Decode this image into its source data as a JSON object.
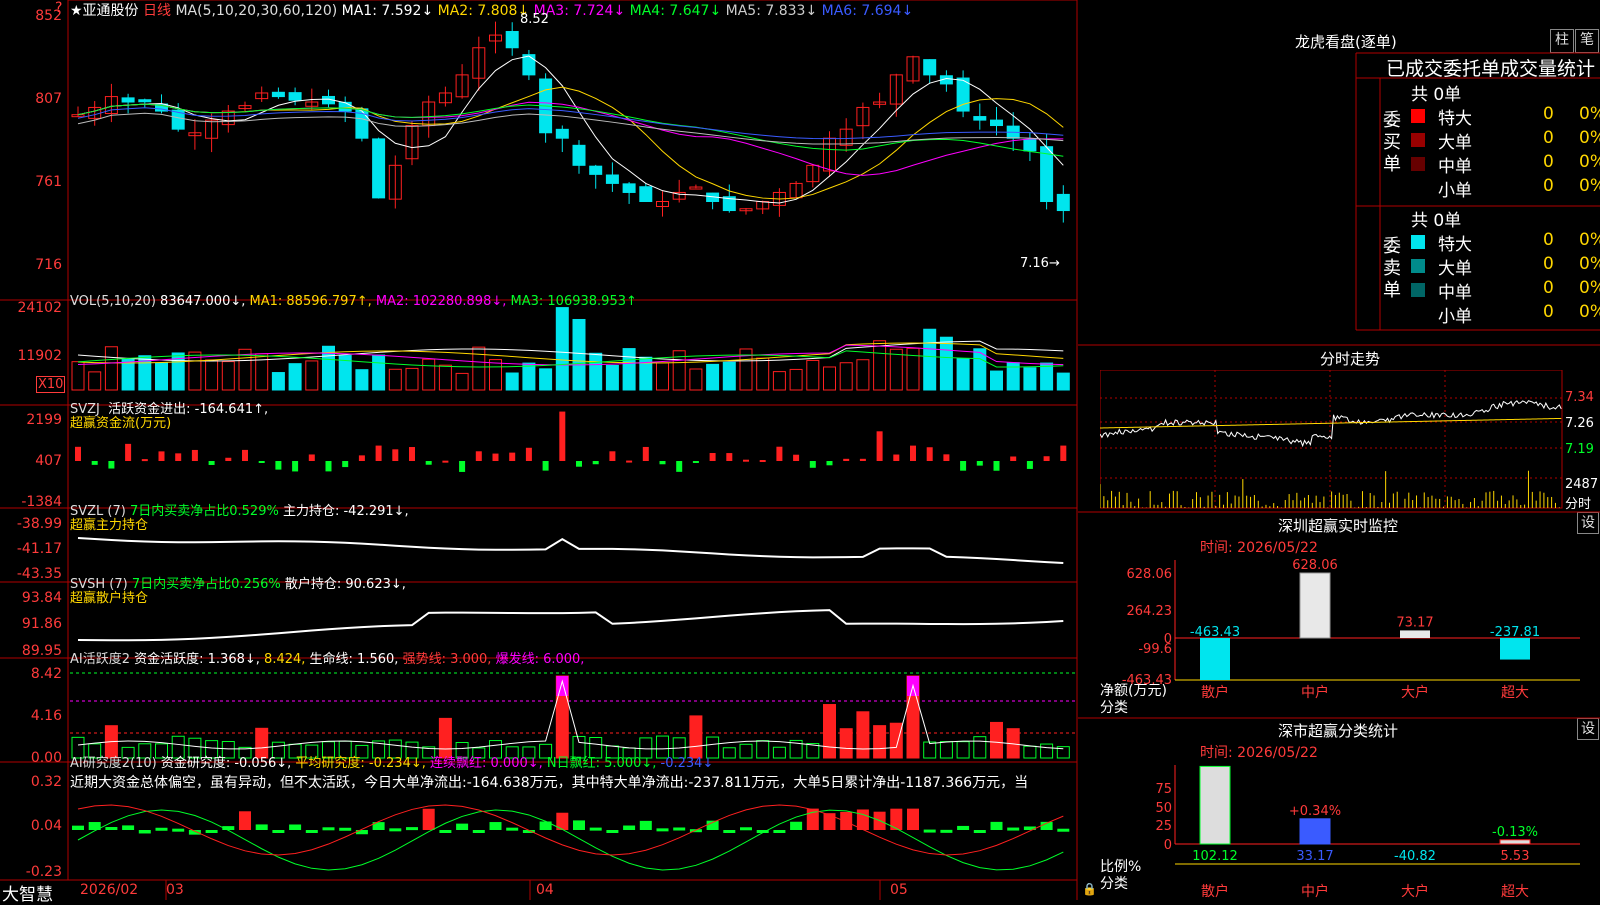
{
  "colors": {
    "up": "#ff2020",
    "down": "#00e5ee",
    "green": "#00ff2a",
    "yellow": "#ffd700",
    "magenta": "#ff00ff",
    "white": "#ffffff",
    "border": "#b00000",
    "blue": "#3a5bff"
  },
  "main": {
    "stock_name": "★亚通股份",
    "period": "日线",
    "ma_title": "MA(5,10,20,30,60,120)",
    "ma": [
      {
        "t": "MA1: 7.592↓",
        "c": "#fff"
      },
      {
        "t": "MA2: 7.808↓",
        "c": "#ffd700"
      },
      {
        "t": "MA3: 7.724↓",
        "c": "#ff00ff"
      },
      {
        "t": "MA4: 7.647↓",
        "c": "#00ff2a"
      },
      {
        "t": "MA5: 7.833↓",
        "c": "#ccc"
      },
      {
        "t": "MA6: 7.694↓",
        "c": "#3a5bff"
      }
    ],
    "axis": [
      "852",
      "807",
      "761",
      "716"
    ],
    "high_label": "8.52",
    "low_label": "7.16→"
  },
  "vol": {
    "title": "VOL(5,10,20)",
    "v": "83647.000↓,",
    "ma1": "MA1: 88596.797↑,",
    "ma2": "MA2: 102280.898↓,",
    "ma3": "MA3: 106938.953↑",
    "axis": [
      "24102",
      "11902"
    ],
    "unit": "X10"
  },
  "svzj": {
    "title": "SVZJ",
    "line1": "活跃资金进出: -164.641↑,",
    "line2": "超赢资金流(万元)",
    "axis": [
      "2199",
      "407",
      "-1384"
    ]
  },
  "svzl": {
    "title": "SVZL (7)",
    "pct": "7日内买卖净占比0.529%",
    "hold": "主力持仓: -42.291↓,",
    "line2": "超赢主力持仓",
    "axis": [
      "-38.99",
      "-41.17",
      "-43.35"
    ]
  },
  "svsh": {
    "title": "SVSH (7)",
    "pct": "7日内买卖净占比0.256%",
    "hold": "散户持仓: 90.623↓,",
    "line2": "超赢散户持仓",
    "axis": [
      "93.84",
      "91.86",
      "89.95"
    ]
  },
  "ai2": {
    "title": "AI活跃度2",
    "a": "资金活跃度: 1.368↓,",
    "b": "8.424,",
    "c": "生命线: 1.560,",
    "d": "强势线: 3.000,",
    "e": "爆发线: 6.000,",
    "axis": [
      "8.42",
      "4.16",
      "0.00"
    ]
  },
  "ai3": {
    "title": "AI研究度2(10)",
    "a": "资金研究度: -0.056↓,",
    "b": "平均研究度: -0.234↓,",
    "c": "连续飘红: 0.000↓,",
    "d": "N日飘红: 5.000↓,",
    "e": "-0.234↓",
    "desc": "近期大资金总体偏空，虽有异动，但不太活跃，今日大单净流出:-164.638万元，其中特大单净流出:-237.811万元，大单5日累计净出-1187.366万元，当",
    "axis": [
      "0.32",
      "0.04",
      "-0.23"
    ]
  },
  "date_axis": {
    "brand": "大智慧",
    "labels": [
      "2026/02",
      "03",
      "04",
      "05"
    ]
  },
  "right": {
    "title": "龙虎看盘(逐单)",
    "btn1": "柱",
    "btn2": "笔",
    "header": "已成交委托单成交量统计",
    "buy": {
      "side": "委买单",
      "total": "共 0单",
      "rows": [
        {
          "name": "特大",
          "n": "0",
          "p": "0%",
          "c": "#ff0000"
        },
        {
          "name": "大单",
          "n": "0",
          "p": "0%",
          "c": "#990000"
        },
        {
          "name": "中单",
          "n": "0",
          "p": "0%",
          "c": "#660000"
        },
        {
          "name": "小单",
          "n": "0",
          "p": "0%",
          "c": "#000"
        }
      ]
    },
    "sell": {
      "side": "委卖单",
      "total": "共 0单",
      "rows": [
        {
          "name": "特大",
          "n": "0",
          "p": "0%",
          "c": "#00e5ee"
        },
        {
          "name": "大单",
          "n": "0",
          "p": "0%",
          "c": "#008b8b"
        },
        {
          "name": "中单",
          "n": "0",
          "p": "0%",
          "c": "#006666"
        },
        {
          "name": "小单",
          "n": "0",
          "p": "0%",
          "c": "#000"
        }
      ]
    },
    "intraday": {
      "title": "分时走势",
      "axis": [
        "7.34",
        "7.26",
        "7.19"
      ],
      "vol_axis": [
        "2487",
        "分时"
      ]
    },
    "monitor": {
      "title": "深圳超赢实时监控",
      "btn": "设",
      "date": "时间: 2026/05/22",
      "axis": [
        "628.06",
        "264.23",
        "0",
        "-99.6",
        "-463.43"
      ],
      "ylabel": "净额(万元)",
      "xlabel": "分类",
      "cats": [
        "散户",
        "中户",
        "大户",
        "超大"
      ],
      "vals": [
        "-463.43",
        "628.06",
        "73.17",
        "-237.81"
      ]
    },
    "stats": {
      "title": "深市超赢分类统计",
      "btn": "设",
      "date": "时间: 2026/05/22",
      "axis": [
        "75",
        "50",
        "25",
        "0"
      ],
      "ylabel": "比例%",
      "xlabel": "分类",
      "cats": [
        "散户",
        "中户",
        "大户",
        "超大"
      ],
      "vals": [
        "102.12",
        "33.17",
        "-40.82",
        "5.53"
      ],
      "pcts": [
        "",
        "+0.34%",
        "",
        "-0.13%"
      ]
    }
  }
}
